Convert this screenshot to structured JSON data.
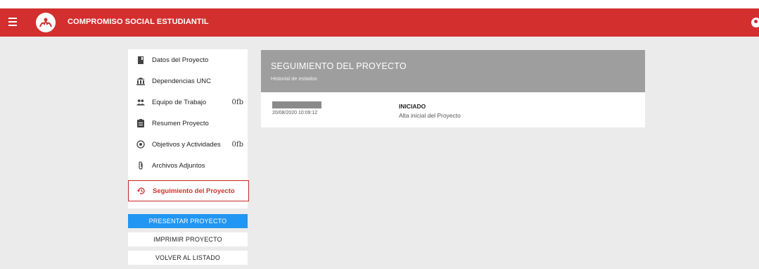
{
  "header": {
    "app_title": "COMPROMISO SOCIAL ESTUDIANTIL",
    "icons": {
      "menu": "menu-icon",
      "logo": "logo-icon",
      "user": "account-icon"
    },
    "color": "#d32f2f"
  },
  "sidebar": {
    "items": [
      {
        "label": "Datos del Proyecto",
        "icon": "book-icon",
        "count": ""
      },
      {
        "label": "Dependencias UNC",
        "icon": "institution-icon",
        "count": ""
      },
      {
        "label": "Equipo de Trabajo",
        "icon": "group-icon",
        "count": "0fb"
      },
      {
        "label": "Resumen Proyecto",
        "icon": "document-icon",
        "count": ""
      },
      {
        "label": "Objetivos y Actividades",
        "icon": "target-icon",
        "count": "0fb"
      },
      {
        "label": "Archivos Adjuntos",
        "icon": "paperclip-icon",
        "count": ""
      },
      {
        "label": "Seguimiento del Proyecto",
        "icon": "history-icon",
        "count": "",
        "active": true
      }
    ]
  },
  "actions": {
    "present": "PRESENTAR PROYECTO",
    "print": "IMPRIMIR PROYECTO",
    "back": "VOLVER AL LISTADO",
    "primary_color": "#2196f3"
  },
  "panel": {
    "title": "SEGUIMIENTO DEL PROYECTO",
    "subtitle": "Historial de estados",
    "entries": [
      {
        "date": "20/08/2020 10:09:12",
        "status": "INICIADO",
        "description": "Alta inicial del Proyecto"
      }
    ]
  }
}
